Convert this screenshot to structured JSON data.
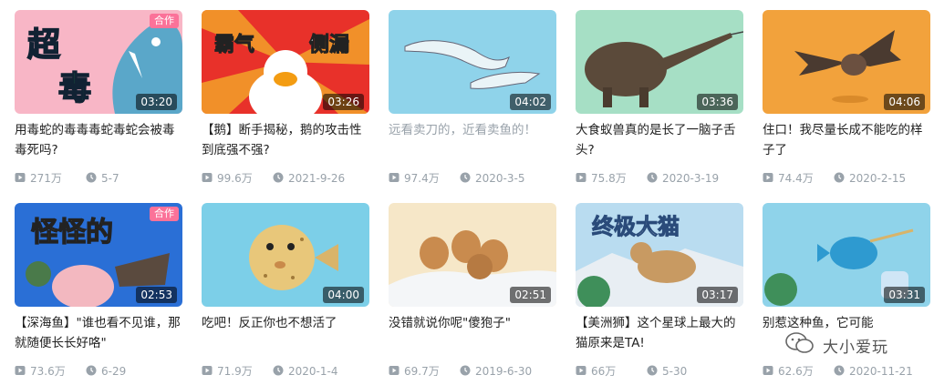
{
  "videos": [
    {
      "title": "用毒蛇的毒毒毒蛇毒蛇会被毒毒死吗?",
      "duration": "03:20",
      "views": "271万",
      "date": "5-7",
      "badge": "合作",
      "thumb_text": "超毒",
      "bg": "#f8b6c6"
    },
    {
      "title": "【鹅】断手揭秘，鹅的攻击性到底强不强?",
      "duration": "03:26",
      "views": "99.6万",
      "date": "2021-9-26",
      "thumb_text": "霸气 侧漏",
      "bg": "#e8312a"
    },
    {
      "title": "远看卖刀的，近看卖鱼的！",
      "duration": "04:02",
      "views": "97.4万",
      "date": "2020-3-5",
      "bg": "#8fd3ea"
    },
    {
      "title": "大食蚁兽真的是长了一脑子舌头?",
      "duration": "03:36",
      "views": "75.8万",
      "date": "2020-3-19",
      "bg": "#a6dfc5"
    },
    {
      "title": "住口！我尽量长成不能吃的样子了",
      "duration": "04:06",
      "views": "74.4万",
      "date": "2020-2-15",
      "bg": "#f2a23c"
    },
    {
      "title": "【深海鱼】\"谁也看不见谁，那就随便长长好咯\"",
      "duration": "02:53",
      "views": "73.6万",
      "date": "6-29",
      "badge": "合作",
      "thumb_text": "怪怪的",
      "bg": "#2a6fd6"
    },
    {
      "title": "吃吧！反正你也不想活了",
      "duration": "04:00",
      "views": "71.9万",
      "date": "2020-1-4",
      "bg": "#7ccfe8"
    },
    {
      "title": "没错就说你呢\"傻狍子\"",
      "duration": "02:51",
      "views": "69.7万",
      "date": "2019-6-30",
      "bg": "#f6e7c8"
    },
    {
      "title": "【美洲狮】这个星球上最大的猫原来是TA!",
      "duration": "03:17",
      "views": "66万",
      "date": "5-30",
      "thumb_text": "终极大猫",
      "bg": "#b9dcf0"
    },
    {
      "title": "别惹这种鱼，它可能",
      "duration": "03:31",
      "views": "62.6万",
      "date": "2020-11-21",
      "bg": "#8fd3ea"
    }
  ],
  "watermark": "大小爱玩",
  "icons": {
    "views": "play-count-icon",
    "date": "clock-icon"
  }
}
